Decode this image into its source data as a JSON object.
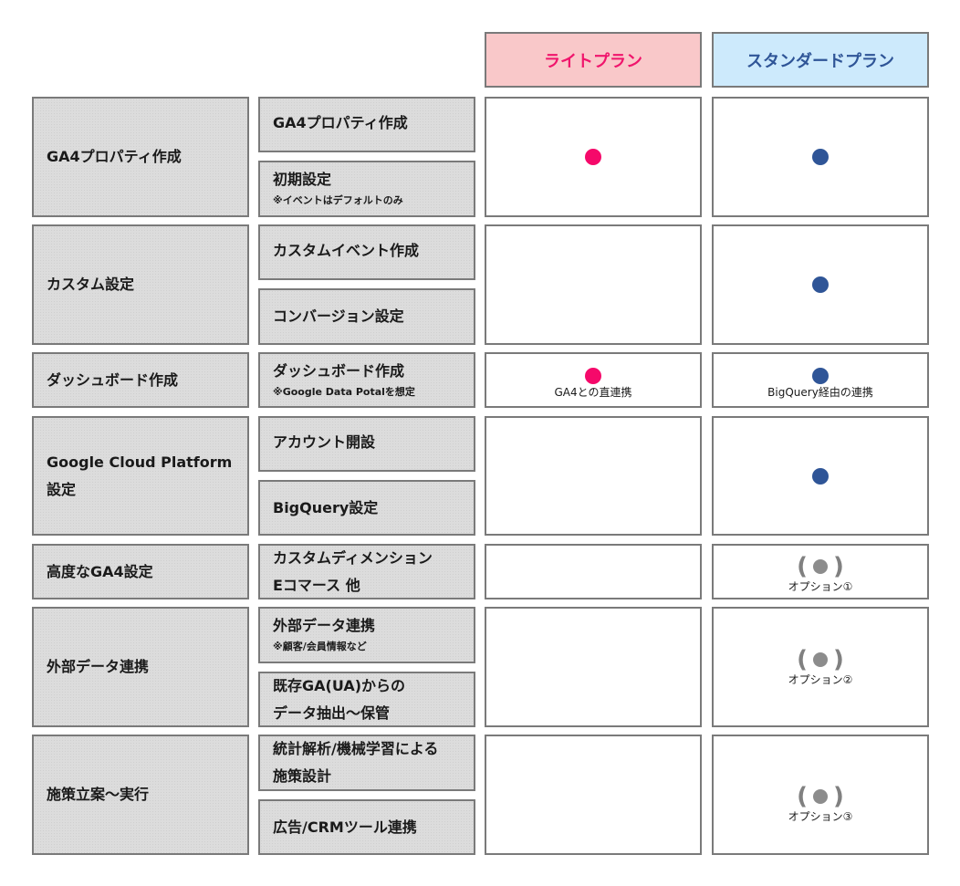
{
  "plans": {
    "lite": {
      "label": "ライトプラン",
      "color": "#f0156c",
      "bg": "#f9c8c9"
    },
    "standard": {
      "label": "スタンダードプラン",
      "color": "#2f5597",
      "bg": "#cdeafc"
    }
  },
  "rows": [
    {
      "category": "GA4プロパティ作成",
      "items": [
        {
          "title": "GA4プロパティ作成",
          "note": ""
        },
        {
          "title": "初期設定",
          "note": "※イベントはデフォルトのみ"
        }
      ],
      "lite": {
        "mark": "included",
        "note": ""
      },
      "standard": {
        "mark": "included",
        "note": ""
      }
    },
    {
      "category": "カスタム設定",
      "items": [
        {
          "title": "カスタムイベント作成",
          "note": ""
        },
        {
          "title": "コンバージョン設定",
          "note": ""
        }
      ],
      "lite": {
        "mark": "none",
        "note": ""
      },
      "standard": {
        "mark": "included",
        "note": ""
      }
    },
    {
      "category": "ダッシュボード作成",
      "items": [
        {
          "title": "ダッシュボード作成",
          "note": "※Google Data Potalを想定"
        }
      ],
      "lite": {
        "mark": "included",
        "note": "GA4との直連携"
      },
      "standard": {
        "mark": "included",
        "note": "BigQuery経由の連携"
      }
    },
    {
      "category_lines": [
        "Google Cloud Platform",
        "設定"
      ],
      "items": [
        {
          "title": "アカウント開設",
          "note": ""
        },
        {
          "title": "BigQuery設定",
          "note": ""
        }
      ],
      "lite": {
        "mark": "none",
        "note": ""
      },
      "standard": {
        "mark": "included",
        "note": ""
      }
    },
    {
      "category": "高度なGA4設定",
      "items": [
        {
          "title_lines": [
            "カスタムディメンション",
            "Eコマース 他"
          ],
          "note": ""
        }
      ],
      "lite": {
        "mark": "none",
        "note": ""
      },
      "standard": {
        "mark": "option",
        "note": "オプション①"
      }
    },
    {
      "category": "外部データ連携",
      "items": [
        {
          "title": "外部データ連携",
          "note": "※顧客/会員情報など"
        },
        {
          "title_lines": [
            "既存GA(UA)からの",
            "データ抽出～保管"
          ],
          "note": ""
        }
      ],
      "lite": {
        "mark": "none",
        "note": ""
      },
      "standard": {
        "mark": "option",
        "note": "オプション②"
      }
    },
    {
      "category": "施策立案～実行",
      "items": [
        {
          "title_lines": [
            "統計解析/機械学習による",
            "施策設計"
          ],
          "note": ""
        },
        {
          "title": "広告/CRMツール連携",
          "note": ""
        }
      ],
      "lite": {
        "mark": "none",
        "note": ""
      },
      "standard": {
        "mark": "option",
        "note": "オプション③"
      }
    }
  ],
  "option_mark": {
    "open": "(",
    "close": ")"
  }
}
